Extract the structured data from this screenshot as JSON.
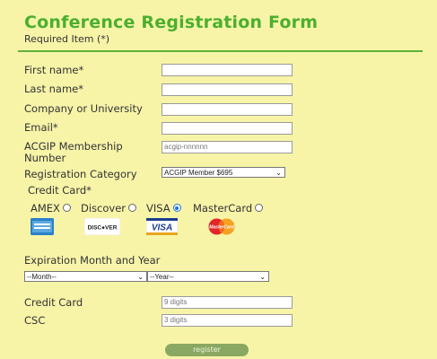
{
  "header": {
    "title": "Conference Registration Form",
    "subtitle": "Required Item (*)"
  },
  "fields": {
    "first_name_label": "First name*",
    "last_name_label": "Last name*",
    "company_label": "Company or University",
    "email_label": "Email*",
    "membership_label_line1": "ACGIP Membership",
    "membership_label_line2": "Number",
    "membership_placeholder": "acgip-nnnnnn",
    "category_label": "Registration Category",
    "category_value": "ACGIP Member $695",
    "credit_card_heading": "Credit Card*"
  },
  "card_options": [
    {
      "label": "AMEX",
      "selected": false
    },
    {
      "label": "Discover",
      "selected": false
    },
    {
      "label": "VISA",
      "selected": true
    },
    {
      "label": "MasterCard",
      "selected": false
    }
  ],
  "card_logos": {
    "discover_text": "DISC●VER",
    "visa_text": "VISA",
    "mastercard_text": "MasterCard"
  },
  "expiration": {
    "label": "Expiration Month and Year",
    "month_value": "--Month--",
    "year_value": "--Year--"
  },
  "payment": {
    "card_label": "Credit Card",
    "card_placeholder": "9 digits",
    "csc_label": "CSC",
    "csc_placeholder": "3 digits"
  },
  "submit_label": "register",
  "colors": {
    "background": "#f7f4a8",
    "title": "#4caf2e",
    "rule": "#5cb338",
    "button": "#8aa862"
  }
}
